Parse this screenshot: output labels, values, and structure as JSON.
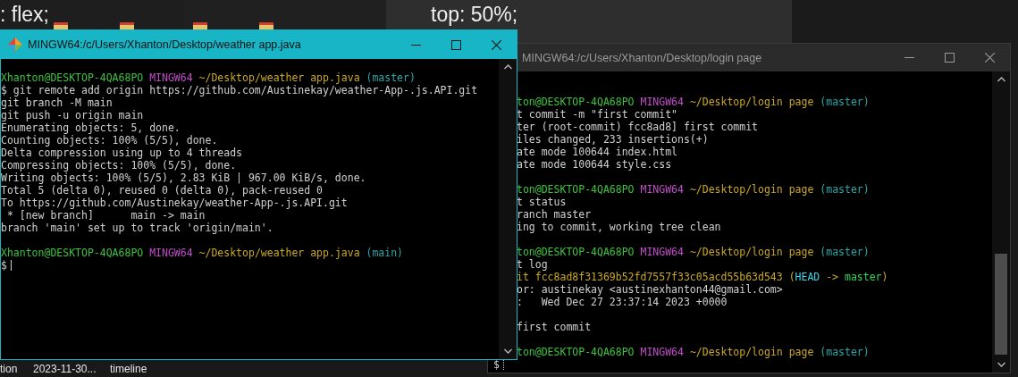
{
  "background": {
    "editor_left_text": ": flex;",
    "editor_right_text": "top: 50%;",
    "file_row": [
      "tion",
      "2023-11-30...",
      "timeline"
    ]
  },
  "windows": [
    {
      "title": "MINGW64:/c/Users/Xhanton/Desktop/weather app.java",
      "focused": true,
      "lines": [
        {
          "kind": "blank"
        },
        {
          "kind": "text",
          "segments": [
            {
              "text": "Xhanton@DESKTOP-4QA68PO",
              "color": "#3fc13f"
            },
            {
              "text": " MINGW64",
              "color": "#c04ec8"
            },
            {
              "text": " ~/Desktop/weather app.java",
              "color": "#c8a826"
            },
            {
              "text": " (master)",
              "color": "#2aa6a6"
            }
          ]
        },
        {
          "kind": "text",
          "segments": [
            {
              "text": "$ git remote add origin https://github.com/Austinekay/weather-App-.js.API.git",
              "color": "#d0d0d0"
            }
          ]
        },
        {
          "kind": "text",
          "segments": [
            {
              "text": "git branch -M main",
              "color": "#d0d0d0"
            }
          ]
        },
        {
          "kind": "text",
          "segments": [
            {
              "text": "git push -u origin main",
              "color": "#d0d0d0"
            }
          ]
        },
        {
          "kind": "text",
          "segments": [
            {
              "text": "Enumerating objects: 5, done.",
              "color": "#d0d0d0"
            }
          ]
        },
        {
          "kind": "text",
          "segments": [
            {
              "text": "Counting objects: 100% (5/5), done.",
              "color": "#d0d0d0"
            }
          ]
        },
        {
          "kind": "text",
          "segments": [
            {
              "text": "Delta compression using up to 4 threads",
              "color": "#d0d0d0"
            }
          ]
        },
        {
          "kind": "text",
          "segments": [
            {
              "text": "Compressing objects: 100% (5/5), done.",
              "color": "#d0d0d0"
            }
          ]
        },
        {
          "kind": "text",
          "segments": [
            {
              "text": "Writing objects: 100% (5/5), 2.83 KiB | 967.00 KiB/s, done.",
              "color": "#d0d0d0"
            }
          ]
        },
        {
          "kind": "text",
          "segments": [
            {
              "text": "Total 5 (delta 0), reused 0 (delta 0), pack-reused 0",
              "color": "#d0d0d0"
            }
          ]
        },
        {
          "kind": "text",
          "segments": [
            {
              "text": "To https://github.com/Austinekay/weather-App-.js.API.git",
              "color": "#d0d0d0"
            }
          ]
        },
        {
          "kind": "text",
          "segments": [
            {
              "text": " * [new branch]      main -> main",
              "color": "#d0d0d0"
            }
          ]
        },
        {
          "kind": "text",
          "segments": [
            {
              "text": "branch 'main' set up to track 'origin/main'.",
              "color": "#d0d0d0"
            }
          ]
        },
        {
          "kind": "blank"
        },
        {
          "kind": "text",
          "segments": [
            {
              "text": "Xhanton@DESKTOP-4QA68PO",
              "color": "#3fc13f"
            },
            {
              "text": " MINGW64",
              "color": "#c04ec8"
            },
            {
              "text": " ~/Desktop/weather app.java",
              "color": "#c8a826"
            },
            {
              "text": " (main)",
              "color": "#2aa6a6"
            }
          ]
        },
        {
          "kind": "input",
          "segments": [
            {
              "text": "$",
              "color": "#d0d0d0"
            }
          ]
        }
      ]
    },
    {
      "title": "MINGW64:/c/Users/Xhanton/Desktop/login page",
      "focused": false,
      "lines": [
        {
          "kind": "blank"
        },
        {
          "kind": "text",
          "segments": [
            {
              "text": "ton@DESKTOP-4QA68PO",
              "color": "#3fc13f"
            },
            {
              "text": " MINGW64",
              "color": "#c04ec8"
            },
            {
              "text": " ~/Desktop/login page",
              "color": "#c8a826"
            },
            {
              "text": " (master)",
              "color": "#2aa6a6"
            }
          ]
        },
        {
          "kind": "text",
          "segments": [
            {
              "text": "t commit -m \"first commit\"",
              "color": "#d0d0d0"
            }
          ]
        },
        {
          "kind": "text",
          "segments": [
            {
              "text": "ter (root-commit) fcc8ad8] first commit",
              "color": "#d0d0d0"
            }
          ]
        },
        {
          "kind": "text",
          "segments": [
            {
              "text": "iles changed, 233 insertions(+)",
              "color": "#d0d0d0"
            }
          ]
        },
        {
          "kind": "text",
          "segments": [
            {
              "text": "ate mode 100644 index.html",
              "color": "#d0d0d0"
            }
          ]
        },
        {
          "kind": "text",
          "segments": [
            {
              "text": "ate mode 100644 style.css",
              "color": "#d0d0d0"
            }
          ]
        },
        {
          "kind": "blank"
        },
        {
          "kind": "text",
          "segments": [
            {
              "text": "ton@DESKTOP-4QA68PO",
              "color": "#3fc13f"
            },
            {
              "text": " MINGW64",
              "color": "#c04ec8"
            },
            {
              "text": " ~/Desktop/login page",
              "color": "#c8a826"
            },
            {
              "text": " (master)",
              "color": "#2aa6a6"
            }
          ]
        },
        {
          "kind": "text",
          "segments": [
            {
              "text": "t status",
              "color": "#d0d0d0"
            }
          ]
        },
        {
          "kind": "text",
          "segments": [
            {
              "text": "ranch master",
              "color": "#d0d0d0"
            }
          ]
        },
        {
          "kind": "text",
          "segments": [
            {
              "text": "ing to commit, working tree clean",
              "color": "#d0d0d0"
            }
          ]
        },
        {
          "kind": "blank"
        },
        {
          "kind": "text",
          "segments": [
            {
              "text": "ton@DESKTOP-4QA68PO",
              "color": "#3fc13f"
            },
            {
              "text": " MINGW64",
              "color": "#c04ec8"
            },
            {
              "text": " ~/Desktop/login page",
              "color": "#c8a826"
            },
            {
              "text": " (master)",
              "color": "#2aa6a6"
            }
          ]
        },
        {
          "kind": "text",
          "segments": [
            {
              "text": "t log",
              "color": "#d0d0d0"
            }
          ]
        },
        {
          "kind": "text",
          "segments": [
            {
              "text": "it fcc8ad8f31369b52fd7557f33c05acd55b63d543 (",
              "color": "#c8a826"
            },
            {
              "text": "HEAD",
              "color": "#3ad6e6"
            },
            {
              "text": " -> ",
              "color": "#c8a826"
            },
            {
              "text": "master",
              "color": "#2fd45a"
            },
            {
              "text": ")",
              "color": "#c8a826"
            }
          ]
        },
        {
          "kind": "text",
          "segments": [
            {
              "text": "or: austinekay <austinexhanton44@gmail.com>",
              "color": "#d0d0d0"
            }
          ]
        },
        {
          "kind": "text",
          "segments": [
            {
              "text": ":   Wed Dec 27 23:37:14 2023 +0000",
              "color": "#d0d0d0"
            }
          ]
        },
        {
          "kind": "blank"
        },
        {
          "kind": "text",
          "segments": [
            {
              "text": "first commit",
              "color": "#d0d0d0"
            }
          ]
        },
        {
          "kind": "blank"
        },
        {
          "kind": "text",
          "segments": [
            {
              "text": "ton@DESKTOP-4QA68PO",
              "color": "#3fc13f"
            },
            {
              "text": " MINGW64",
              "color": "#c04ec8"
            },
            {
              "text": " ~/Desktop/login page",
              "color": "#c8a826"
            },
            {
              "text": " (master)",
              "color": "#2aa6a6"
            }
          ]
        },
        {
          "kind": "input",
          "segments": [
            {
              "text": "$",
              "color": "#d0d0d0"
            }
          ]
        }
      ]
    }
  ]
}
